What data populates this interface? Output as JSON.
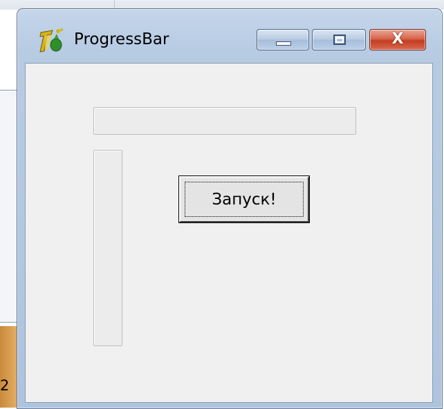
{
  "window": {
    "title": "ProgressBar",
    "icon": "delphi-app-icon",
    "close_glyph": "X"
  },
  "progress_horizontal": {
    "value": 0
  },
  "progress_vertical": {
    "value": 0
  },
  "launch_button": {
    "label": "Запуск!"
  },
  "background": {
    "stray_text": "2"
  },
  "colors": {
    "title_bar": "#b7cbe3",
    "client": "#f0f0f0",
    "close_button": "#c43d22",
    "progress_fill": "#06b025"
  }
}
